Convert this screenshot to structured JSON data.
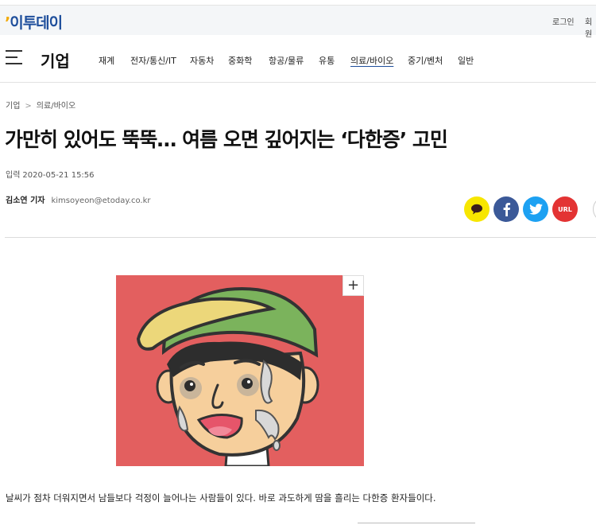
{
  "header": {
    "logo": "이투데이",
    "login": "로그인",
    "join": "회원"
  },
  "nav": {
    "section": "기업",
    "items": [
      "재계",
      "전자/통신/IT",
      "자동차",
      "중화학",
      "항공/물류",
      "유통",
      "의료/바이오",
      "중기/벤처",
      "일반"
    ],
    "active": "의료/바이오"
  },
  "breadcrumb": [
    "기업",
    "의료/바이오"
  ],
  "article": {
    "headline": "가만히 있어도 뚝뚝… 여름 오면 깊어지는 ‘다한증’ 고민",
    "date_label": "입력",
    "date": "2020-05-21 15:56",
    "reporter": "김소연 기자",
    "email": "kimsoyeon@etoday.co.kr",
    "zoom": "+",
    "body": "날씨가 점차 더워지면서 남들보다 걱정이 늘어나는 사람들이 있다. 바로 과도하게 땀을 흘리는 다한증 환자들이다."
  },
  "share": {
    "url_label": "URL"
  },
  "colors": {
    "brand": "#1f4f9c",
    "kakao": "#f7e600",
    "facebook": "#3b5998",
    "twitter": "#1da1f2",
    "url": "#e33333",
    "figure_bg": "#e35f5f"
  }
}
